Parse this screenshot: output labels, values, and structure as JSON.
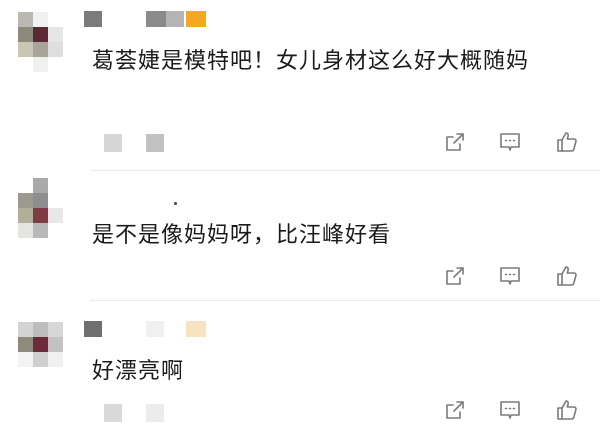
{
  "comments": [
    {
      "text": "葛荟婕是模特吧！女儿身材这么好大概随妈",
      "actions": {
        "share": "share-icon",
        "reply": "comment-icon",
        "like": "thumbs-up-icon"
      }
    },
    {
      "text": "是不是像妈妈呀，比汪峰好看",
      "actions": {
        "share": "share-icon",
        "reply": "comment-icon",
        "like": "thumbs-up-icon"
      }
    },
    {
      "text": "好漂亮啊",
      "actions": {
        "share": "share-icon",
        "reply": "comment-icon",
        "like": "thumbs-up-icon"
      }
    }
  ],
  "colors": {
    "text": "#1a1a1a",
    "icon": "#7a7a7a",
    "divider": "#ebebeb",
    "accent_orange": "#f5a623"
  }
}
